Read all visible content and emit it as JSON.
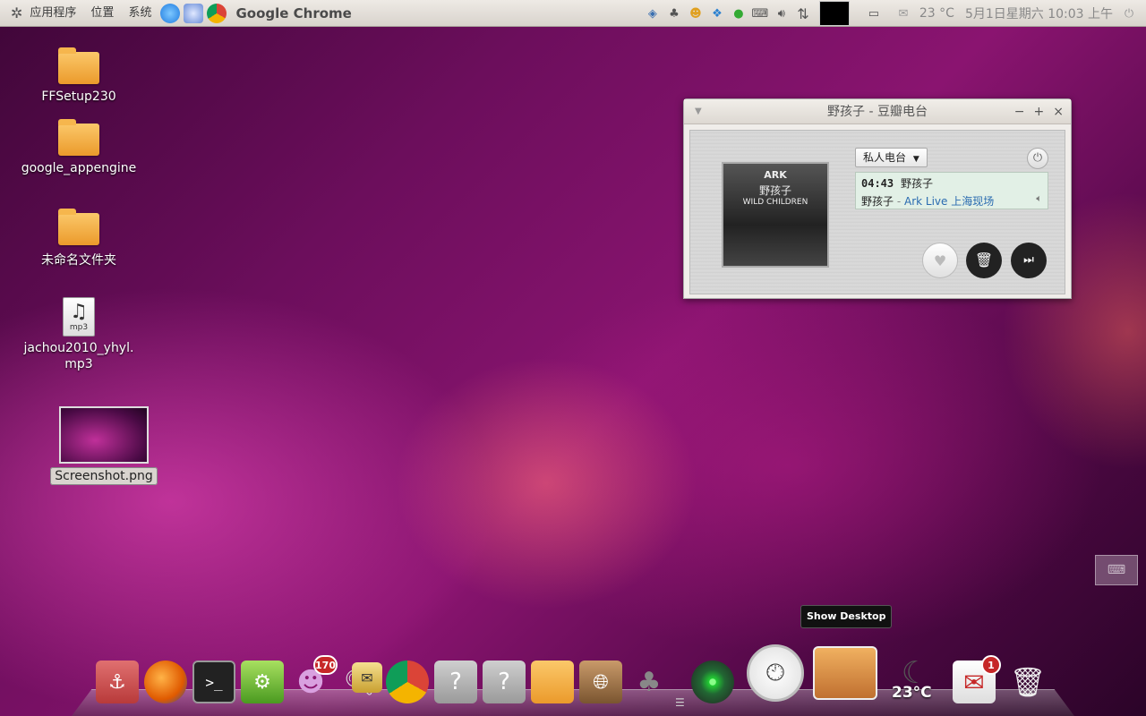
{
  "top_panel": {
    "menus": [
      "应用程序",
      "位置",
      "系统"
    ],
    "active_app": "Google Chrome",
    "temperature": "23 °C",
    "datetime": "5月1日星期六 10:03 上午"
  },
  "desktop": {
    "icons": [
      {
        "label": "FFSetup230",
        "type": "folder"
      },
      {
        "label": "google_appengine",
        "type": "folder"
      },
      {
        "label": "未命名文件夹",
        "type": "folder"
      },
      {
        "label": "jachou2010_yhyl.\nmp3",
        "type": "mp3",
        "file_badge": "mp3"
      },
      {
        "label": "Screenshot.png",
        "type": "image"
      }
    ]
  },
  "player": {
    "window_title": "野孩子 - 豆瓣电台",
    "channel": "私人电台",
    "time": "04:43",
    "song": "野孩子",
    "artist": "野孩子",
    "separator": " - ",
    "album": "Ark Live 上海现场",
    "album_art": {
      "band": "ARK",
      "title_cn": "野孩子",
      "title_en": "WILD CHILDREN"
    }
  },
  "tooltip": "Show Desktop",
  "dock": {
    "badges": {
      "chat": "170",
      "mail": "1"
    },
    "weather_temp": "23°C"
  },
  "colors": {
    "panel_bg": "#e4e0db",
    "wallpaper_main": "#8a1470",
    "now_playing_bg": "#e2f0e6",
    "album_link": "#2a6bb0",
    "badge_red": "#c62828"
  }
}
